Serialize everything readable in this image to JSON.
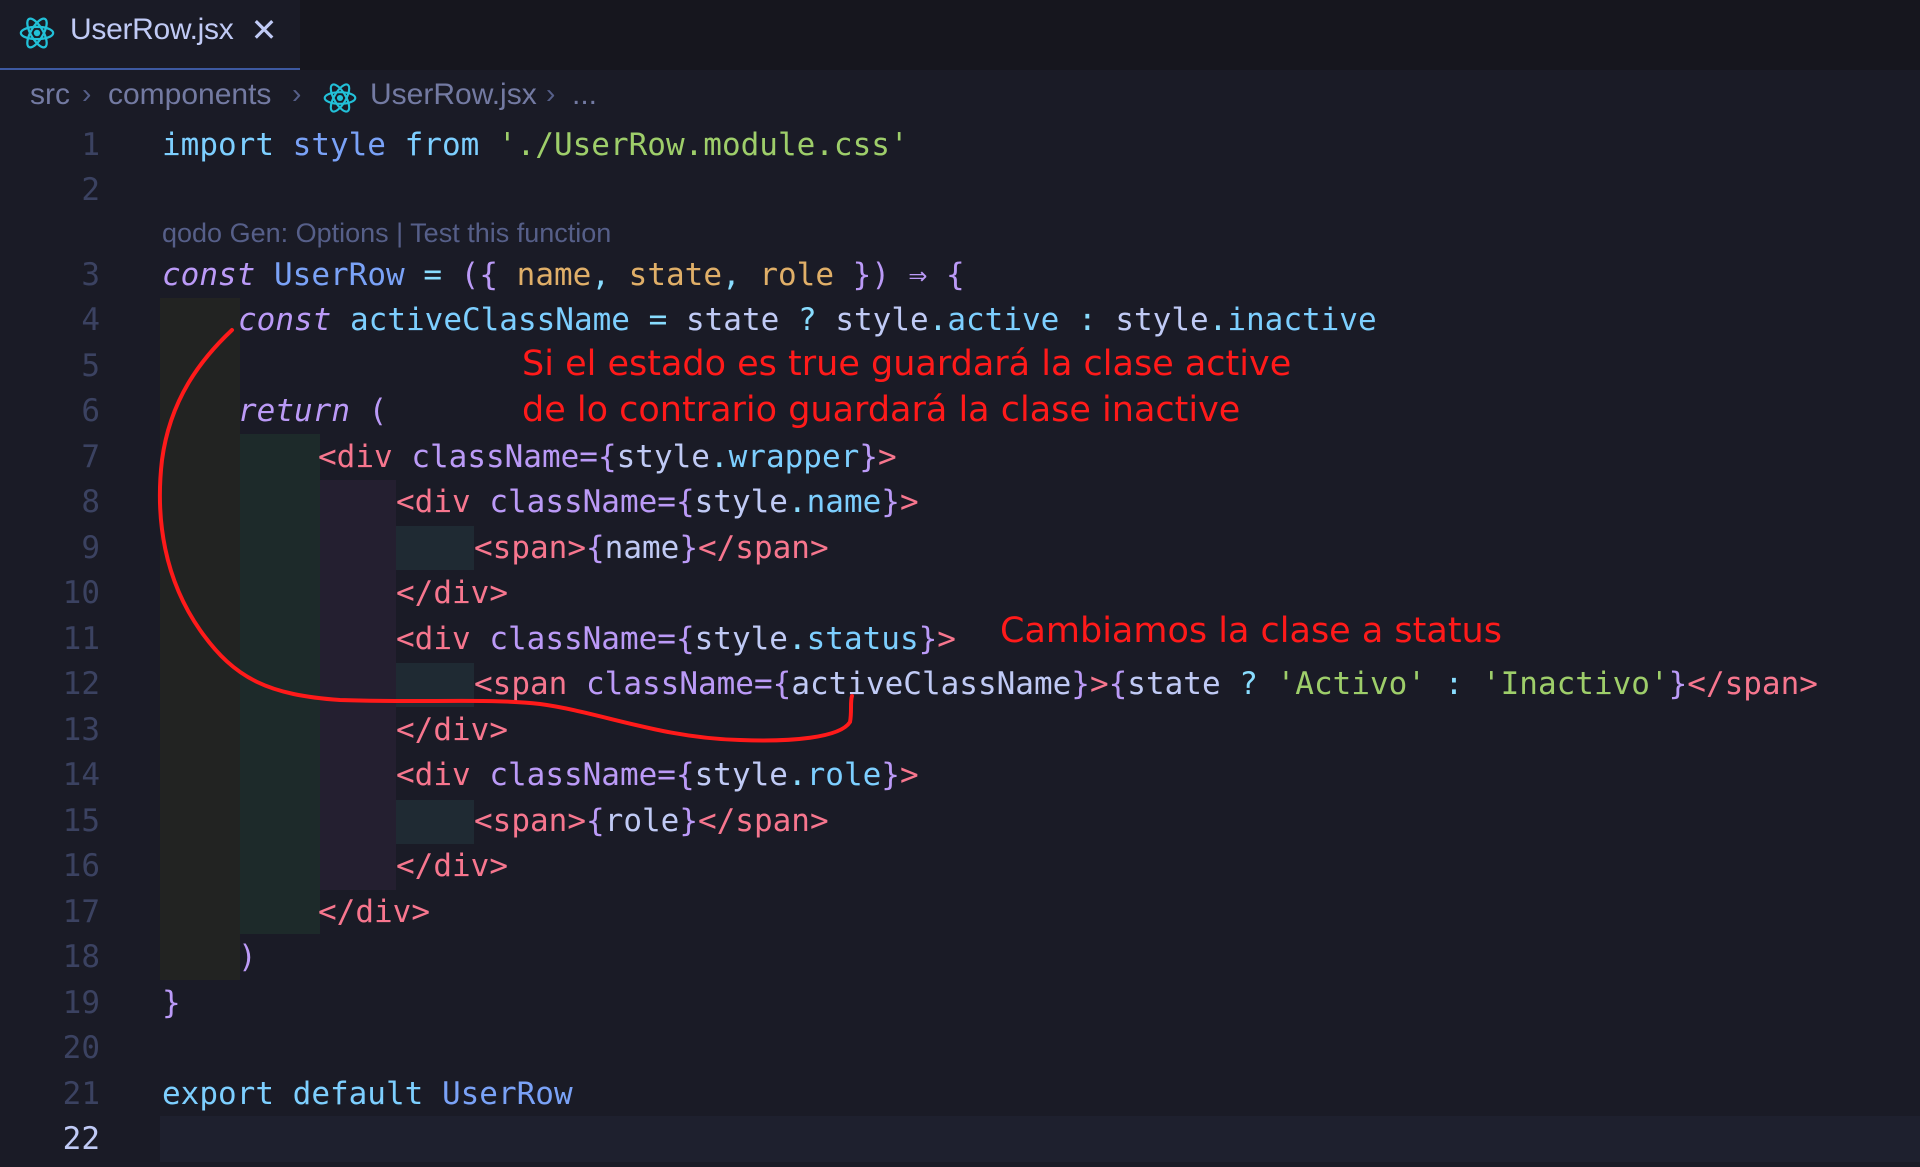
{
  "editor": {
    "tab": {
      "label": "UserRow.jsx",
      "close_glyph": "✕",
      "icon": "react-icon"
    },
    "breadcrumb": {
      "items": [
        "src",
        "components",
        "UserRow.jsx",
        "..."
      ],
      "separator": "›",
      "file_icon": "react-icon"
    },
    "codelens": "qodo Gen: Options | Test this function",
    "line_numbers": [
      "1",
      "2",
      "3",
      "4",
      "5",
      "6",
      "7",
      "8",
      "9",
      "10",
      "11",
      "12",
      "13",
      "14",
      "15",
      "16",
      "17",
      "18",
      "19",
      "20",
      "21",
      "22"
    ],
    "current_line": "22",
    "lines": {
      "l1": {
        "import": "import",
        "style": "style",
        "from": "from",
        "path": "'./UserRow.module.css'"
      },
      "l3": {
        "const": "const",
        "name": "UserRow",
        "eq": "=",
        "open": "({",
        "p1": "name",
        "c1": ",",
        "p2": "state",
        "c2": ",",
        "p3": "role",
        "close": "})",
        "arrow": "⇒",
        "brace": "{"
      },
      "l4": {
        "const": "const",
        "var": "activeClassName",
        "eq": "=",
        "state": "state",
        "q": "?",
        "style1": "style",
        "dot1": ".",
        "active": "active",
        "colon": ":",
        "style2": "style",
        "dot2": ".",
        "inactive": "inactive"
      },
      "l6": {
        "return": "return",
        "paren": "("
      },
      "l7": {
        "open": "<div",
        "attr": "className=",
        "lb": "{",
        "obj": "style",
        "dot": ".",
        "prop": "wrapper",
        "rb": "}",
        "close": ">"
      },
      "l8": {
        "open": "<div",
        "attr": "className=",
        "lb": "{",
        "obj": "style",
        "dot": ".",
        "prop": "name",
        "rb": "}",
        "close": ">"
      },
      "l9": {
        "open": "<span>",
        "lb": "{",
        "val": "name",
        "rb": "}",
        "close": "</span>"
      },
      "l10": {
        "close": "</div>"
      },
      "l11": {
        "open": "<div",
        "attr": "className=",
        "lb": "{",
        "obj": "style",
        "dot": ".",
        "prop": "status",
        "rb": "}",
        "close": ">"
      },
      "l12": {
        "open": "<span",
        "attr": "className=",
        "lb": "{",
        "val": "activeClassName",
        "rb": "}",
        "gt": ">",
        "lb2": "{",
        "state": "state",
        "q": "?",
        "s1": "'Activo'",
        "colon": ":",
        "s2": "'Inactivo'",
        "rb2": "}",
        "close": "</span>"
      },
      "l13": {
        "close": "</div>"
      },
      "l14": {
        "open": "<div",
        "attr": "className=",
        "lb": "{",
        "obj": "style",
        "dot": ".",
        "prop": "role",
        "rb": "}",
        "close": ">"
      },
      "l15": {
        "open": "<span>",
        "lb": "{",
        "val": "role",
        "rb": "}",
        "close": "</span>"
      },
      "l16": {
        "close": "</div>"
      },
      "l17": {
        "close": "</div>"
      },
      "l18": {
        "paren": ")"
      },
      "l19": {
        "brace": "}"
      },
      "l21": {
        "export": "export",
        "default": "default",
        "name": "UserRow"
      }
    },
    "annotations": {
      "a1_line1": "Si el estado es true guardará la clase active",
      "a1_line2": "de lo contrario guardará la clase inactive",
      "a2": "Cambiamos la clase a status"
    },
    "colors": {
      "background": "#1a1b26",
      "annotation": "#ff1a1a",
      "keyword": "#bb9af7",
      "string": "#9ece6a",
      "tag": "#f7768e"
    }
  }
}
